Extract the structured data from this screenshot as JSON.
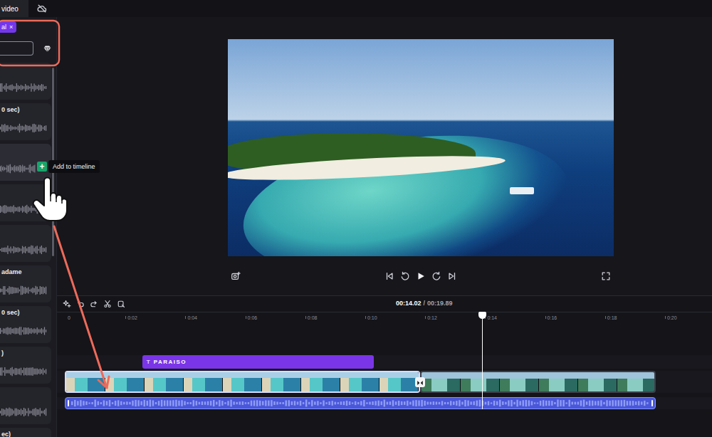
{
  "top_tabs": [
    {
      "label": "video",
      "selected": true
    }
  ],
  "filter_chips": [
    {
      "label": "al",
      "remove": "×"
    }
  ],
  "search": {
    "placeholder": ""
  },
  "audio_items": [
    {
      "hovered": false
    },
    {
      "title": "0 sec)",
      "hovered": false
    },
    {
      "hovered": true
    },
    {
      "hovered": false
    },
    {
      "hovered": false
    },
    {
      "title": "adame",
      "hovered": false
    },
    {
      "title": "0 sec)",
      "hovered": false
    },
    {
      "title": ")",
      "hovered": false
    },
    {
      "hovered": false
    },
    {
      "title": "ec)",
      "hovered": false
    }
  ],
  "add_button": {
    "label": "+",
    "tooltip": "Add to timeline"
  },
  "timeline": {
    "current_time": "00:14.02",
    "separator": "/",
    "total_time": "00:19.89",
    "ruler": [
      "0",
      "0:02",
      "0:04",
      "0:06",
      "0:08",
      "0:10",
      "0:12",
      "0:14",
      "0:16",
      "0:18",
      "0:20"
    ],
    "playhead_seconds": 13.82,
    "text_clips": [
      {
        "icon": "T",
        "label": "PARAISO",
        "start": 2.49,
        "end": 10.21
      }
    ],
    "video_clips": [
      {
        "start": -0.1,
        "end": 11.76,
        "selected": true
      },
      {
        "start": 11.76,
        "end": 19.62,
        "selected": false
      }
    ],
    "audio_clips": [
      {
        "start": -0.1,
        "end": 19.62,
        "selected": true
      }
    ]
  }
}
